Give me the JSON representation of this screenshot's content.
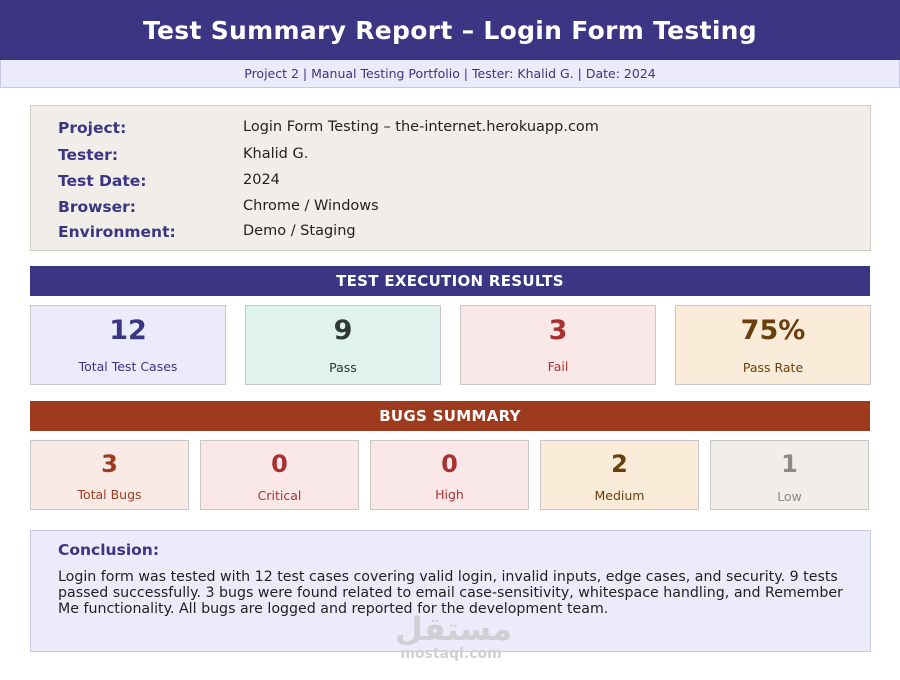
{
  "header": {
    "title": "Test Summary Report – Login Form Testing",
    "subtitle": "Project 2 | Manual Testing Portfolio | Tester: Khalid G. | Date: 2024"
  },
  "info": [
    {
      "label": "Project:",
      "value": "Login Form Testing – the-internet.herokuapp.com"
    },
    {
      "label": "Tester:",
      "value": "Khalid G."
    },
    {
      "label": "Test Date:",
      "value": "2024"
    },
    {
      "label": "Browser:",
      "value": "Chrome / Windows"
    },
    {
      "label": "Environment:",
      "value": "Demo / Staging"
    }
  ],
  "execution": {
    "title": "TEST EXECUTION RESULTS",
    "cards": [
      {
        "value": "12",
        "label": "Total Test Cases"
      },
      {
        "value": "9",
        "label": "Pass"
      },
      {
        "value": "3",
        "label": "Fail"
      },
      {
        "value": "75%",
        "label": "Pass Rate"
      }
    ]
  },
  "bugs": {
    "title": "BUGS SUMMARY",
    "cards": [
      {
        "value": "3",
        "label": "Total Bugs"
      },
      {
        "value": "0",
        "label": "Critical"
      },
      {
        "value": "0",
        "label": "High"
      },
      {
        "value": "2",
        "label": "Medium"
      },
      {
        "value": "1",
        "label": "Low"
      }
    ]
  },
  "conclusion": {
    "title": "Conclusion:",
    "text": "Login form was tested with 12 test cases covering valid login, invalid inputs, edge cases, and security. 9 tests passed successfully. 3 bugs were found related to email case-sensitivity, whitespace handling, and Remember Me functionality. All bugs are logged and reported for the development team."
  },
  "watermark": {
    "logo": "مستقل",
    "text": "mostaql.com"
  },
  "colors": {
    "primary": "#3c3583",
    "bugs_banner": "#9e3b1e",
    "pass": "#2f3a36",
    "fail": "#a83232",
    "pass_rate": "#6b3f0c"
  }
}
